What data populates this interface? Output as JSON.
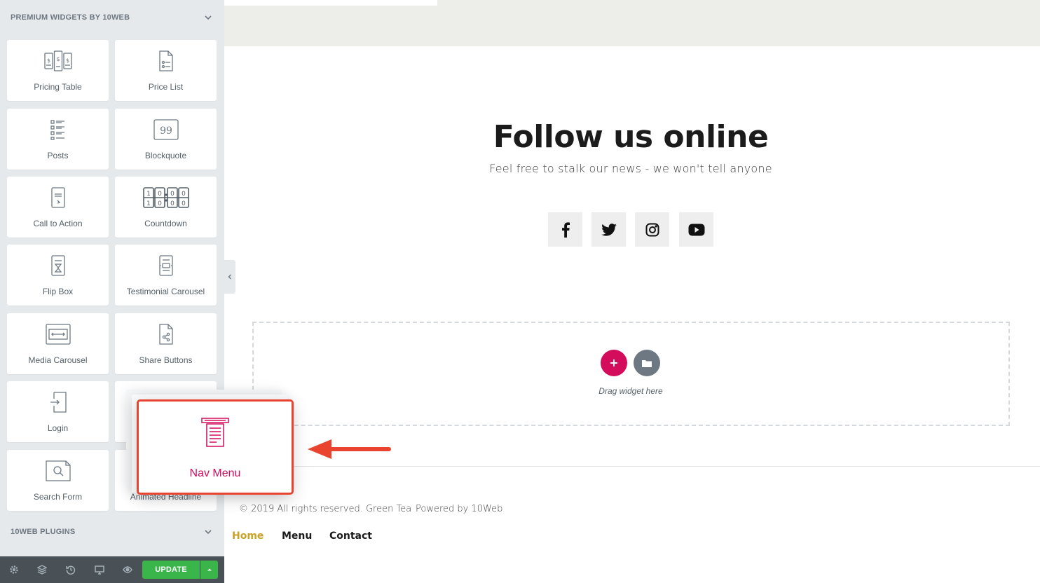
{
  "sidebar": {
    "premium_header": "PREMIUM WIDGETS BY 10WEB",
    "plugins_header": "10WEB PLUGINS",
    "widgets": [
      {
        "label": "Pricing Table",
        "icon": "pricing-table-icon"
      },
      {
        "label": "Price List",
        "icon": "price-list-icon"
      },
      {
        "label": "Posts",
        "icon": "posts-icon"
      },
      {
        "label": "Blockquote",
        "icon": "blockquote-icon"
      },
      {
        "label": "Call to Action",
        "icon": "call-to-action-icon"
      },
      {
        "label": "Countdown",
        "icon": "countdown-icon"
      },
      {
        "label": "Flip Box",
        "icon": "flip-box-icon"
      },
      {
        "label": "Testimonial Carousel",
        "icon": "testimonial-carousel-icon"
      },
      {
        "label": "Media Carousel",
        "icon": "media-carousel-icon"
      },
      {
        "label": "Share Buttons",
        "icon": "share-buttons-icon"
      },
      {
        "label": "Login",
        "icon": "login-icon"
      },
      {
        "label": "Animated Headline",
        "icon": "animated-headline-icon"
      },
      {
        "label": "Search Form",
        "icon": "search-form-icon"
      }
    ]
  },
  "toolbar": {
    "update_label": "UPDATE",
    "icons": [
      "gear-icon",
      "layers-icon",
      "history-icon",
      "responsive-icon",
      "preview-eye-icon",
      "caret-up-icon"
    ]
  },
  "canvas": {
    "title": "Follow us online",
    "subtitle": "Feel free to stalk our news - we won't tell anyone",
    "social_icons": [
      "facebook-icon",
      "twitter-icon",
      "instagram-icon",
      "youtube-icon"
    ],
    "drop_zone_text": "Drag widget here",
    "copyright": "© 2019 All rights reserved. Green Tea",
    "powered_by": "Powered by 10Web",
    "footer_nav": [
      "Home",
      "Menu",
      "Contact"
    ]
  },
  "dragged_widget": {
    "label": "Nav Menu",
    "icon": "nav-menu-icon"
  },
  "colors": {
    "accent": "#d30c5c",
    "update_green": "#39b54a",
    "highlight_red": "#e8442f",
    "home_gold": "#c9a227"
  }
}
